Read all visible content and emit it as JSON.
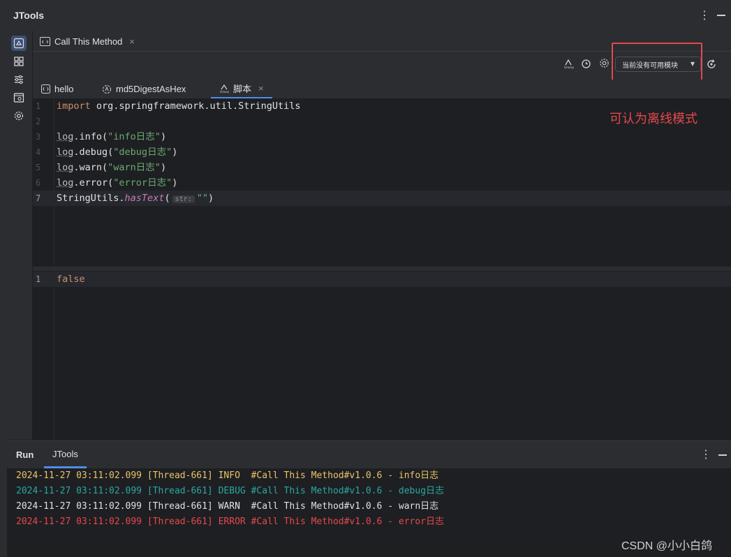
{
  "window": {
    "title": "JTools",
    "more_icon": "vertical-dots-icon",
    "minimize_icon": "minimize-icon"
  },
  "sidebar": {
    "items": [
      {
        "icon": "recycle-icon",
        "active": true
      },
      {
        "icon": "grid-icon",
        "active": false
      },
      {
        "icon": "sliders-icon",
        "active": false
      },
      {
        "icon": "browser-search-icon",
        "active": false
      },
      {
        "icon": "gear-icon",
        "active": false
      }
    ]
  },
  "call_tab": {
    "label": "Call This Method",
    "close": "×"
  },
  "toolbar": {
    "module_select": {
      "value": "当前没有可用模块",
      "arrow": "▾"
    },
    "icons": [
      "groovy-icon",
      "history-icon",
      "gear-icon",
      "refresh-icon"
    ]
  },
  "annotation": "可认为离线模式",
  "editor_tabs": [
    {
      "label": "hello",
      "icon": "java-file-icon",
      "active": false
    },
    {
      "label": "md5DigestAsHex",
      "icon": "method-icon",
      "active": false
    },
    {
      "label": "脚本",
      "icon": "groovy-icon",
      "active": true,
      "close": "×"
    }
  ],
  "editor": {
    "lines": [
      {
        "n": "1",
        "kind": "import",
        "kw": "import",
        "rest": " org.springframework.util.StringUtils"
      },
      {
        "n": "2",
        "kind": "empty"
      },
      {
        "n": "3",
        "kind": "log",
        "obj": "log",
        "method": ".info(",
        "str": "\"info日志\"",
        "tail": ")"
      },
      {
        "n": "4",
        "kind": "log",
        "obj": "log",
        "method": ".debug(",
        "str": "\"debug日志\"",
        "tail": ")"
      },
      {
        "n": "5",
        "kind": "log",
        "obj": "log",
        "method": ".warn(",
        "str": "\"warn日志\"",
        "tail": ")"
      },
      {
        "n": "6",
        "kind": "log",
        "obj": "log",
        "method": ".error(",
        "str": "\"error日志\"",
        "tail": ")"
      },
      {
        "n": "7",
        "kind": "call",
        "obj": "StringUtils.",
        "fn": "hasText",
        "open": "(",
        "hint": "str:",
        "str": "\"\"",
        "tail": ")"
      }
    ]
  },
  "output": {
    "lines": [
      {
        "n": "1",
        "text": "false"
      }
    ]
  },
  "run_panel": {
    "tabs": [
      {
        "label": "Run",
        "active": false
      },
      {
        "label": "JTools",
        "active": true
      }
    ],
    "logs": [
      {
        "text": "2024-11-27 03:11:02.099 [Thread-661] INFO  #Call This Method#v1.0.6 - info日志",
        "color": "#e8c46a"
      },
      {
        "text": "2024-11-27 03:11:02.099 [Thread-661] DEBUG #Call This Method#v1.0.6 - debug日志",
        "color": "#2aa7a0"
      },
      {
        "text": "2024-11-27 03:11:02.099 [Thread-661] WARN  #Call This Method#v1.0.6 - warn日志",
        "color": "#dfe1e5"
      },
      {
        "text": "2024-11-27 03:11:02.099 [Thread-661] ERROR #Call This Method#v1.0.6 - error日志",
        "color": "#e5484d"
      }
    ]
  },
  "watermark": "CSDN @小小白鸽",
  "colors": {
    "accent": "#4d8ee8",
    "annotation_red": "#e5484d",
    "background": "#1e1f22",
    "panel": "#2b2d30"
  }
}
